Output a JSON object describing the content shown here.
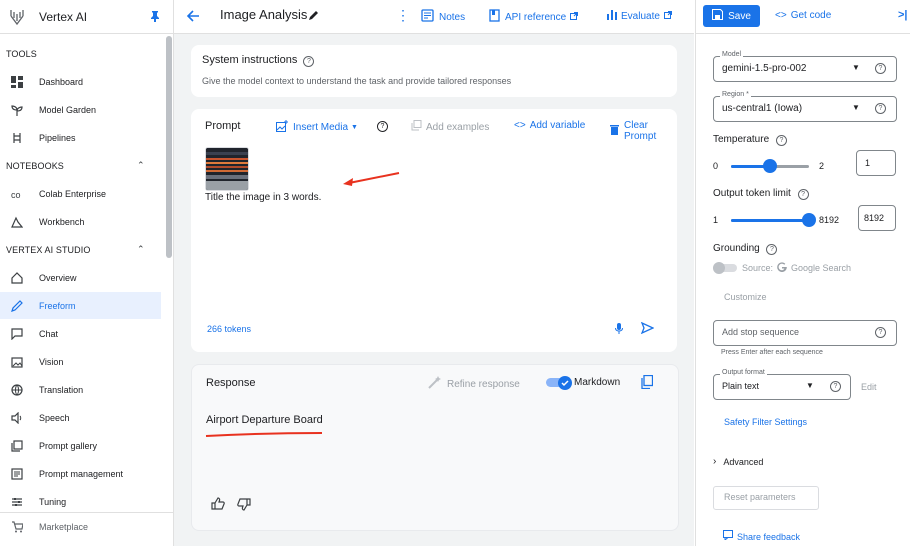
{
  "app": {
    "title": "Vertex AI"
  },
  "sidebar": {
    "sections": {
      "tools": "TOOLS",
      "notebooks": "NOTEBOOKS",
      "studio": "VERTEX AI STUDIO"
    },
    "items": [
      {
        "label": "Dashboard"
      },
      {
        "label": "Model Garden"
      },
      {
        "label": "Pipelines"
      },
      {
        "label": "Colab Enterprise"
      },
      {
        "label": "Workbench"
      },
      {
        "label": "Overview"
      },
      {
        "label": "Freeform"
      },
      {
        "label": "Chat"
      },
      {
        "label": "Vision"
      },
      {
        "label": "Translation"
      },
      {
        "label": "Speech"
      },
      {
        "label": "Prompt gallery"
      },
      {
        "label": "Prompt management"
      },
      {
        "label": "Tuning"
      }
    ],
    "marketplace": "Marketplace"
  },
  "header": {
    "title": "Image Analysis",
    "notes": "Notes",
    "api_reference": "API reference",
    "evaluate": "Evaluate"
  },
  "system_instructions": {
    "title": "System instructions",
    "subtitle": "Give the model context to understand the task and provide tailored responses"
  },
  "prompt": {
    "title": "Prompt",
    "insert_media": "Insert Media",
    "add_examples": "Add examples",
    "add_variable": "Add variable",
    "clear_prompt": "Clear Prompt",
    "text": "Title the image in 3 words.",
    "tokens": "266 tokens"
  },
  "response": {
    "title": "Response",
    "refine": "Refine response",
    "markdown": "Markdown",
    "text": "Airport Departure Board",
    "markdown_on": true
  },
  "settings": {
    "save": "Save",
    "get_code": "Get code",
    "model": {
      "label": "Model",
      "value": "gemini-1.5-pro-002"
    },
    "region": {
      "label": "Region *",
      "value": "us-central1 (Iowa)"
    },
    "temperature": {
      "label": "Temperature",
      "min": "0",
      "max": "2",
      "value": "1",
      "fraction": 0.5
    },
    "output_limit": {
      "label": "Output token limit",
      "min": "1",
      "max": "8192",
      "value": "8192",
      "fraction": 1.0
    },
    "grounding": {
      "label": "Grounding",
      "source": "Source:",
      "google_search": "Google Search"
    },
    "customize": "Customize",
    "stop_sequence": {
      "placeholder": "Add stop sequence",
      "hint": "Press Enter after each sequence"
    },
    "output_format": {
      "label": "Output format",
      "value": "Plain text",
      "edit": "Edit"
    },
    "safety": "Safety Filter Settings",
    "advanced": "Advanced",
    "reset": "Reset parameters",
    "share_feedback": "Share feedback"
  },
  "colors": {
    "accent": "#1a73e8",
    "annotation": "#e8321f"
  }
}
